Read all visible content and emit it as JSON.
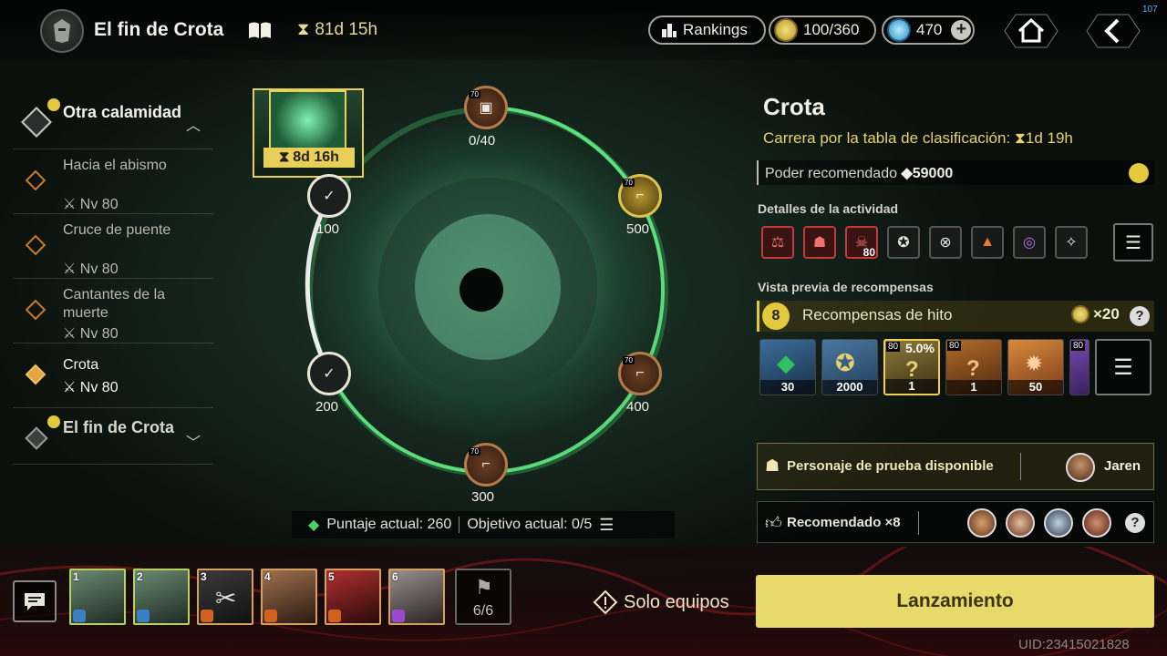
{
  "header": {
    "title": "El fin de Crota",
    "timer": "81d 15h",
    "rankings_label": "Rankings",
    "currency": "100/360",
    "gems": "470",
    "fps": "107"
  },
  "nav": {
    "group_label": "Otra calamidad",
    "items": [
      {
        "label": "Hacia el abismo",
        "level": "Nv 80"
      },
      {
        "label": "Cruce de puente",
        "level": "Nv 80"
      },
      {
        "label": "Cantantes de la muerte",
        "level": "Nv 80"
      },
      {
        "label": "Crota",
        "level": "Nv 80"
      }
    ],
    "footer_label": "El fin de Crota"
  },
  "ring": {
    "boss_timer": "8d 16h",
    "node_level": "70",
    "top_progress": "0/40",
    "labels": [
      "100",
      "500",
      "200",
      "400",
      "300"
    ],
    "score_label": "Puntaje actual: 260",
    "objective_label": "Objetivo actual: 0/5"
  },
  "panel": {
    "name": "Crota",
    "race": "Carrera por la tabla de clasificación:",
    "race_timer": "1d 19h",
    "power_label": "Poder recomendado",
    "power_value": "59000",
    "activity_title": "Detalles de la actividad",
    "activity_badge": "80",
    "rewards_title": "Vista previa de recompensas",
    "milestone_rank": "8",
    "milestone_label": "Recompensas de hito",
    "milestone_mult": "×20",
    "rewards": [
      {
        "qty": "30"
      },
      {
        "qty": "2000"
      },
      {
        "qty": "1",
        "level": "80",
        "chance": "5.0%"
      },
      {
        "qty": "1",
        "level": "80"
      },
      {
        "qty": "50"
      }
    ],
    "partial_reward_level": "80",
    "trial_label": "Personaje de prueba disponible",
    "trial_hero": "Jaren",
    "recommended_label": "Recomendado ×8"
  },
  "team": {
    "slots": [
      "1",
      "2",
      "3",
      "4",
      "5",
      "6"
    ],
    "count": "6/6"
  },
  "solo_label": "Solo equipos",
  "launch_label": "Lanzamiento",
  "uid": "UID:23415021828",
  "colors": {
    "accent": "#e8d96b",
    "ring": "#4fe07a",
    "gold": "#e4c93e"
  }
}
